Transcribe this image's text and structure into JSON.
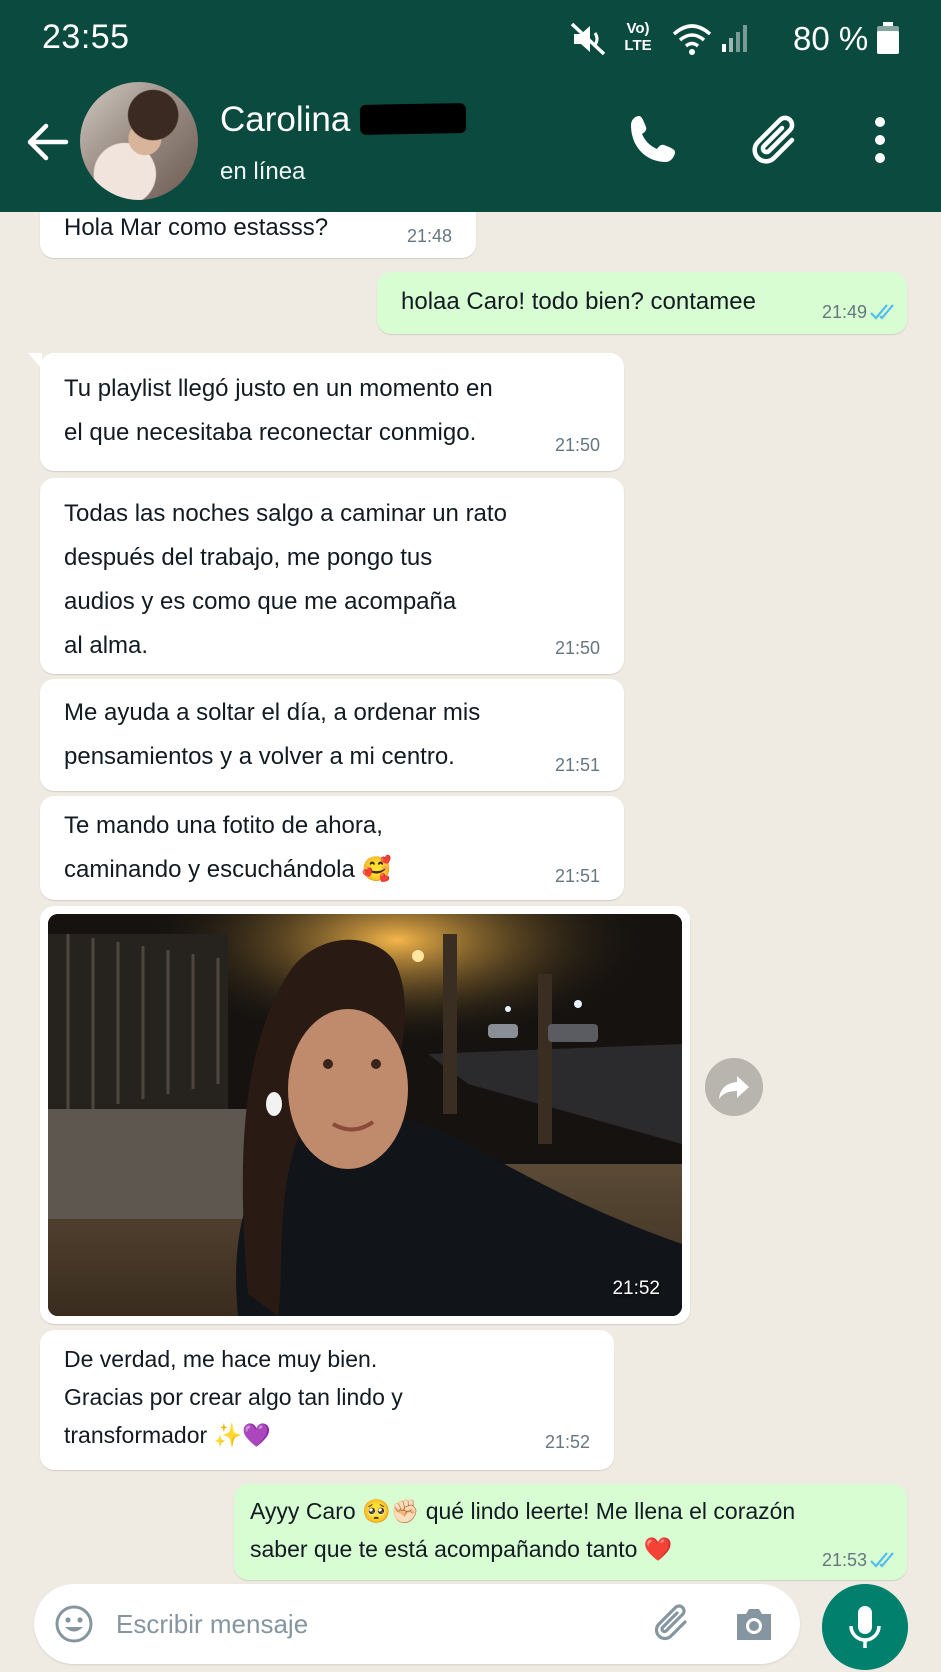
{
  "status_bar": {
    "time": "23:55",
    "volte_line1": "Vo)",
    "volte_line2": "LTE",
    "battery": "80 %",
    "icons": [
      "mute-icon",
      "wifi-icon",
      "signal-icon",
      "battery-icon"
    ]
  },
  "header": {
    "contact_name": "Carolina",
    "contact_status": "en línea",
    "icons": [
      "back-arrow-icon",
      "phone-icon",
      "paperclip-icon",
      "more-vertical-icon"
    ],
    "background_color": "#0b4a3f"
  },
  "messages": [
    {
      "direction": "in",
      "text": "Hola Mar como estasss?",
      "time": "21:48"
    },
    {
      "direction": "out",
      "text": "holaa Caro! todo bien? contamee",
      "time": "21:49",
      "read": true
    },
    {
      "direction": "in",
      "text": "Tu playlist llegó justo en un momento en\nel que necesitaba reconectar conmigo.",
      "time": "21:50"
    },
    {
      "direction": "in",
      "text": "Todas las noches salgo a caminar un rato\ndespués del trabajo, me pongo tus\naudios y es como que me acompaña\nal alma.",
      "time": "21:50"
    },
    {
      "direction": "in",
      "text": "Me ayuda a soltar el día, a ordenar mis\npensamientos y a volver a mi centro.",
      "time": "21:51"
    },
    {
      "direction": "in",
      "text": "Te mando una fotito de ahora,\ncaminando y escuchándola 🥰",
      "time": "21:51"
    },
    {
      "direction": "in",
      "type": "image",
      "time": "21:52"
    },
    {
      "direction": "in",
      "text": "De verdad, me hace muy bien.\nGracias por crear algo tan lindo y\ntransformador ✨💜",
      "time": "21:52"
    },
    {
      "direction": "out",
      "text": "Ayyy Caro 🥺✊🏻 qué lindo leerte! Me llena el corazón\nsaber que te está acompañando tanto ❤️",
      "time": "21:53",
      "read": true
    }
  ],
  "input": {
    "placeholder": "Escribir mensaje",
    "icons": [
      "emoji-icon",
      "paperclip-icon",
      "camera-icon",
      "mic-icon"
    ]
  },
  "colors": {
    "chat_background": "#efeae2",
    "incoming_bubble": "#ffffff",
    "outgoing_bubble": "#d9fdd3",
    "read_ticks": "#53bdeb",
    "mic_button": "#00806d"
  }
}
